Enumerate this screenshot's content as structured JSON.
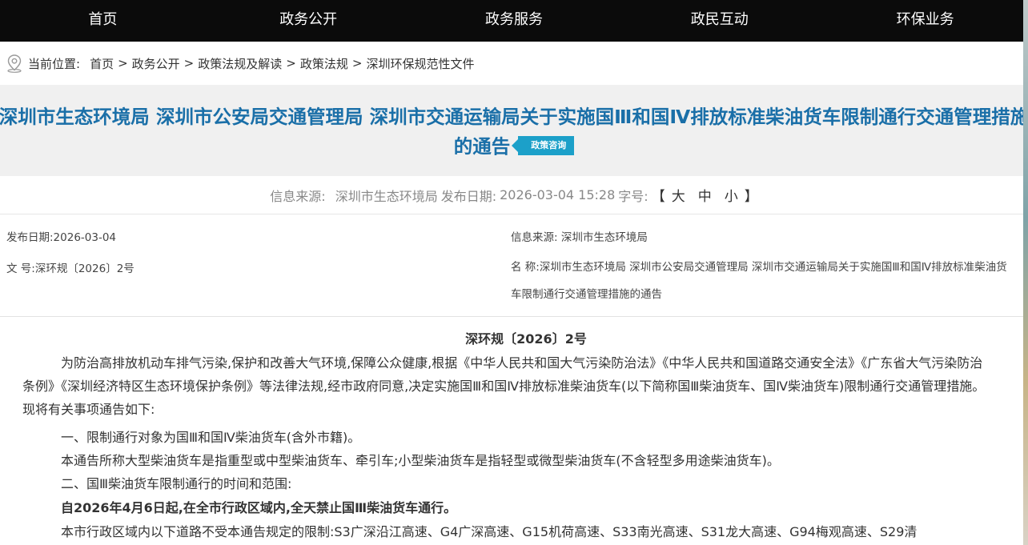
{
  "nav": {
    "items": [
      "首页",
      "政务公开",
      "政务服务",
      "政民互动",
      "环保业务"
    ]
  },
  "breadcrumb": {
    "prefix": "当前位置:",
    "items": [
      "首页",
      "政务公开",
      "政策法规及解读",
      "政策法规",
      "深圳环保规范性文件"
    ],
    "separator": ">"
  },
  "title": {
    "text": "深圳市生态环境局 深圳市公安局交通管理局 深圳市交通运输局关于实施国Ⅲ和国Ⅳ排放标准柴油货车限制通行交通管理措施的通告",
    "tag": "政策咨询"
  },
  "meta": {
    "source_label": "信息来源:",
    "source_value": "深圳市生态环境局",
    "date_label": "发布日期:",
    "date_value": "2026-03-04 15:28",
    "size_label": "字号:",
    "size_open": "【",
    "size_options": [
      "大",
      "中",
      "小"
    ],
    "size_close": "】"
  },
  "info": {
    "publish_date": "发布日期:2026-03-04",
    "doc_number": "文 号:深环规〔2026〕2号",
    "source": "信息来源: 深圳市生态环境局",
    "name": "名 称:深圳市生态环境局 深圳市公安局交通管理局 深圳市交通运输局关于实施国Ⅲ和国Ⅳ排放标准柴油货车限制通行交通管理措施的通告"
  },
  "article": {
    "doc_no": "深环规〔2026〕2号",
    "intro": "为防治高排放机动车排气污染,保护和改善大气环境,保障公众健康,根据《中华人民共和国大气污染防治法》《中华人民共和国道路交通安全法》《广东省大气污染防治条例》《深圳经济特区生态环境保护条例》等法律法规,经市政府同意,决定实施国Ⅲ和国Ⅳ排放标准柴油货车(以下简称国Ⅲ柴油货车、国Ⅳ柴油货车)限制通行交通管理措施。现将有关事项通告如下:",
    "p1": "一、限制通行对象为国Ⅲ和国Ⅳ柴油货车(含外市籍)。",
    "p2": "本通告所称大型柴油货车是指重型或中型柴油货车、牵引车;小型柴油货车是指轻型或微型柴油货车(不含轻型多用途柴油货车)。",
    "p3": "二、国Ⅲ柴油货车限制通行的时间和范围:",
    "p4": "自2026年4月6日起,在全市行政区域内,全天禁止国Ⅲ柴油货车通行。",
    "p5": "本市行政区域内以下道路不受本通告规定的限制:S3广深沿江高速、G4广深高速、G15机荷高速、S33南光高速、S31龙大高速、G94梅观高速、S29清"
  }
}
